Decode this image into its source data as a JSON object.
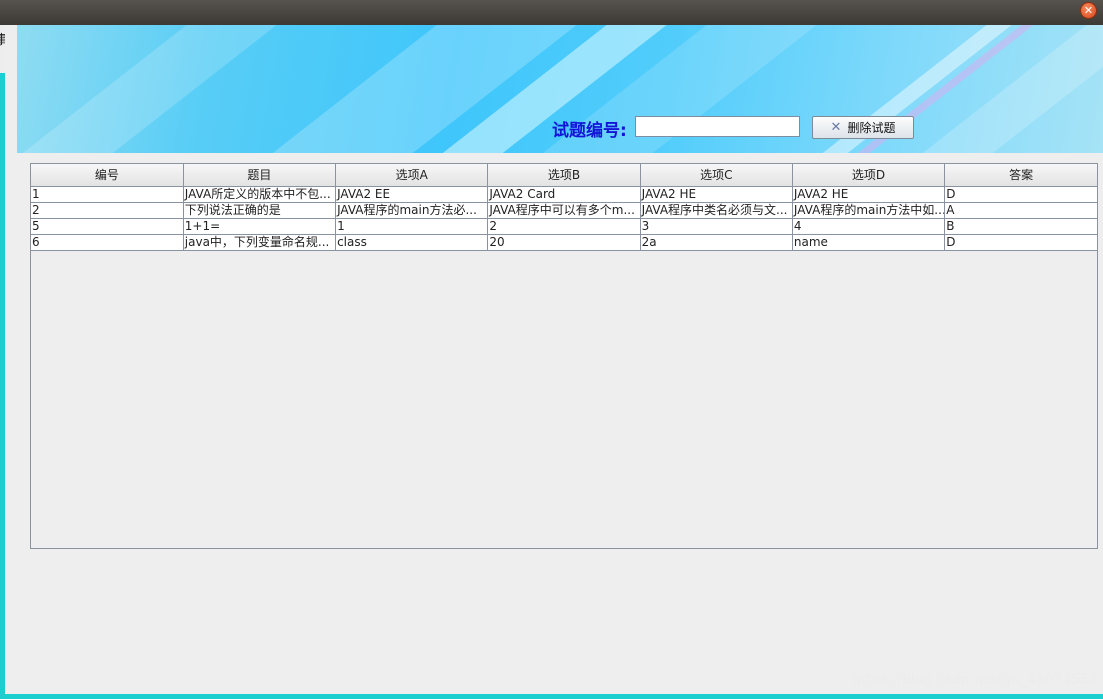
{
  "window": {
    "close_icon": "close-icon",
    "left_edge_char": "事"
  },
  "search": {
    "label": "试题编号:",
    "value": "",
    "button_label": "删除试题",
    "button_icon": "x-icon"
  },
  "table": {
    "columns": [
      "编号",
      "题目",
      "选项A",
      "选项B",
      "选项C",
      "选项D",
      "答案"
    ],
    "rows": [
      [
        "1",
        " JAVA所定义的版本中不包...",
        "JAVA2 EE",
        " JAVA2 Card",
        "JAVA2 HE",
        "JAVA2 HE",
        "D"
      ],
      [
        "2",
        "下列说法正确的是",
        " JAVA程序的main方法必...",
        "JAVA程序中可以有多个m...",
        " JAVA程序中类名必须与文...",
        "JAVA程序的main方法中如...",
        "A"
      ],
      [
        "5",
        "1+1=",
        "1",
        "2",
        "3",
        "4",
        "B"
      ],
      [
        "6",
        "java中，下列变量命名规...",
        "class",
        "20",
        "2a",
        "name",
        "D"
      ]
    ]
  },
  "watermark": "https://blog.csdn.net/qq_43073558"
}
